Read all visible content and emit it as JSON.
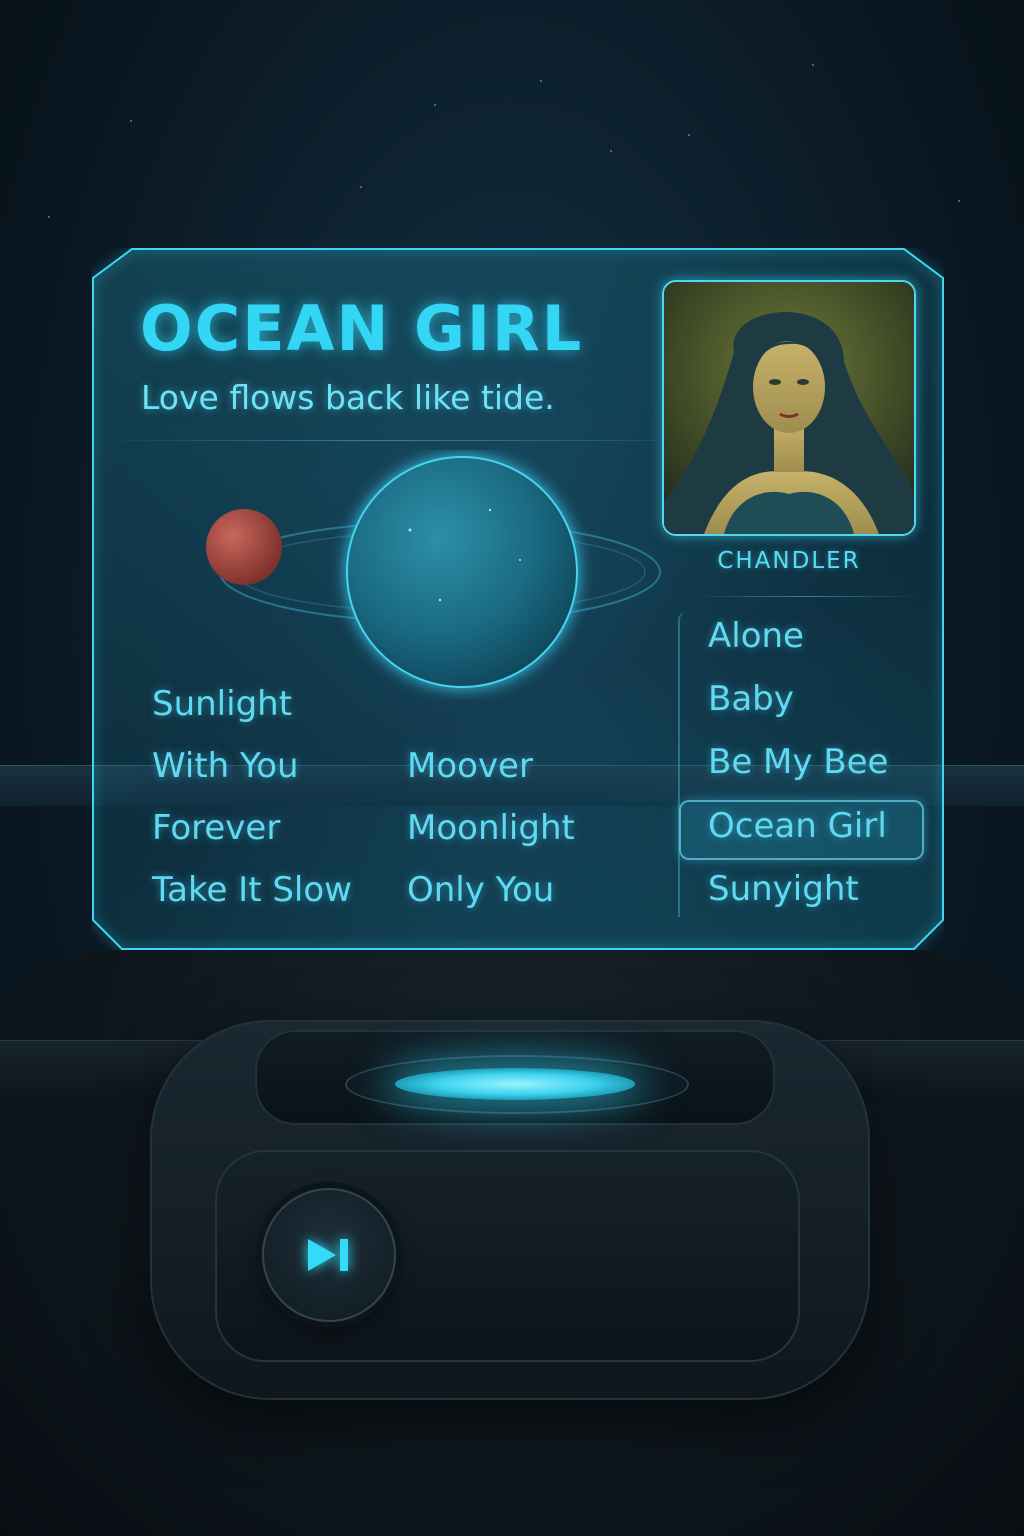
{
  "now_playing": {
    "title": "OCEAN GIRL",
    "subtitle": "Love flows back like tide.",
    "artist": "CHANDLER"
  },
  "album_tracks": [
    "Sunlight",
    "With You",
    "Forever",
    "Take It Slow",
    "Moover",
    "Moonlight",
    "Only You"
  ],
  "playlist": {
    "items": [
      "Alone",
      "Baby",
      "Be My Bee",
      "Ocean Girl",
      "Sunyight"
    ],
    "selected": "Ocean Girl"
  },
  "controls": {
    "next_icon": "skip-next-icon"
  },
  "colors": {
    "accent": "#33d6f5",
    "panel_glow": "#1fa9c9",
    "planet_moon": "#b3524a"
  }
}
